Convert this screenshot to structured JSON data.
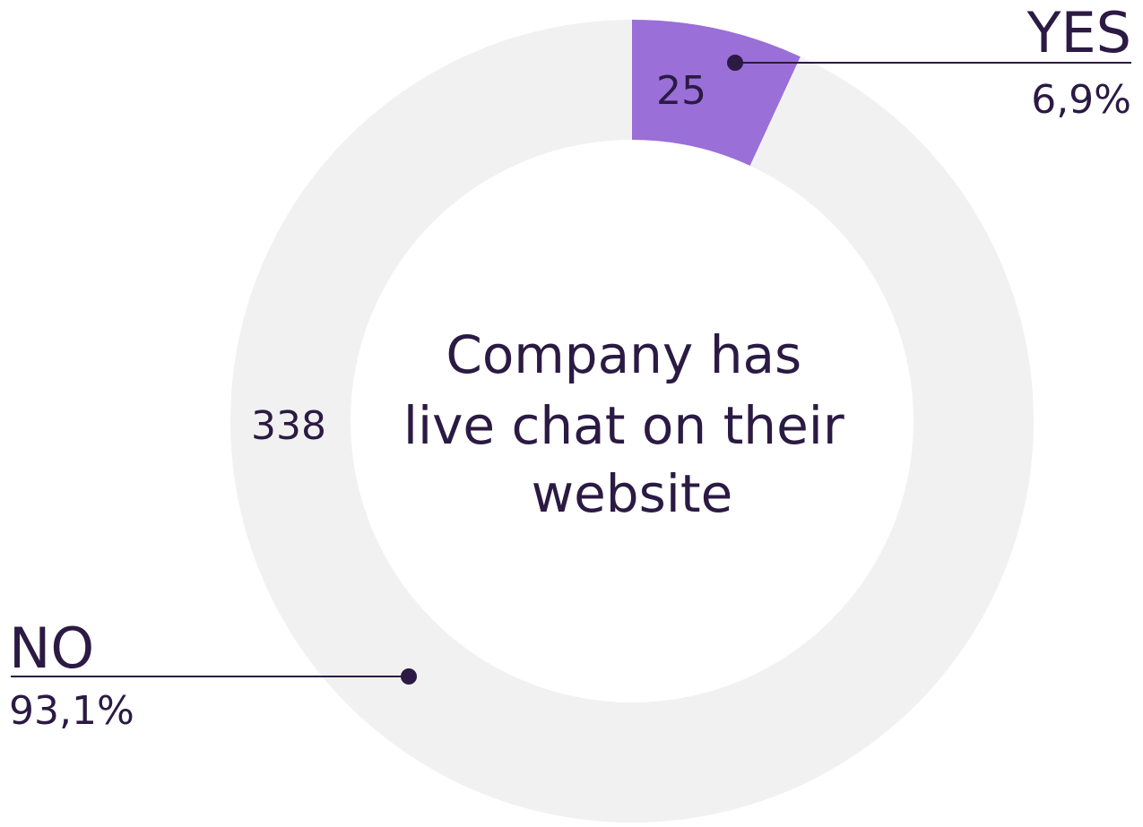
{
  "chart_data": {
    "type": "pie",
    "title": "Company has live chat on their website",
    "title_lines": [
      "Company has",
      "live chat on their",
      "website"
    ],
    "categories": [
      "YES",
      "NO"
    ],
    "values": [
      25,
      338
    ],
    "percent_labels": [
      "6,9%",
      "93,1%"
    ],
    "value_labels": [
      "25",
      "338"
    ],
    "colors": {
      "yes": "#9a6fd8",
      "no": "#f1f1f1",
      "text": "#2b1a43",
      "line": "#2b1a43"
    }
  }
}
